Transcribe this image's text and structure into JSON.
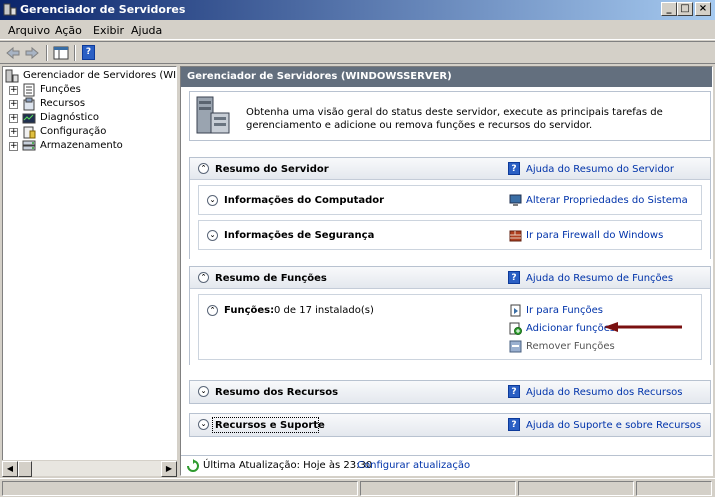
{
  "window": {
    "title": "Gerenciador de Servidores",
    "controls": {
      "minimize": "_",
      "maximize": "□",
      "close": "×"
    }
  },
  "menu": [
    "Arquivo",
    "Ação",
    "Exibir",
    "Ajuda"
  ],
  "toolbar": {
    "icons": [
      "back-arrow-icon",
      "forward-arrow-icon",
      "show-hide-console-tree-icon",
      "help-icon"
    ],
    "help_glyph": "?"
  },
  "tree": {
    "root": "Gerenciador de Servidores (WINDC",
    "items": [
      {
        "label": "Funções",
        "icon": "roles-icon"
      },
      {
        "label": "Recursos",
        "icon": "features-icon"
      },
      {
        "label": "Diagnóstico",
        "icon": "diagnostics-icon"
      },
      {
        "label": "Configuração",
        "icon": "configuration-icon"
      },
      {
        "label": "Armazenamento",
        "icon": "storage-icon"
      }
    ],
    "expander": "+"
  },
  "main": {
    "header": "Gerenciador de Servidores (WINDOWSSERVER)",
    "overview_text": "Obtenha uma visão geral do status deste servidor, execute as principais tarefas de gerenciamento e adicione ou remova funções e recursos do servidor.",
    "server_summary": {
      "title": "Resumo do Servidor",
      "help_link": "Ajuda do Resumo do Servidor",
      "computer_info": {
        "title": "Informações do Computador",
        "link": "Alterar Propriedades do Sistema"
      },
      "security_info": {
        "title": "Informações de Segurança",
        "link": "Ir para Firewall do Windows"
      }
    },
    "roles_summary": {
      "title": "Resumo de Funções",
      "help_link": "Ajuda do Resumo de Funções",
      "roles_label": "Funções:",
      "roles_value": "0 de 17 instalado(s)",
      "links": [
        "Ir para Funções",
        "Adicionar funções",
        "Remover Funções"
      ]
    },
    "features_summary": {
      "title": "Resumo dos Recursos",
      "help_link": "Ajuda do Resumo dos Recursos"
    },
    "resources_support": {
      "title": "Recursos e Suporte",
      "help_link": "Ajuda do Suporte e sobre Recursos"
    },
    "refresh": {
      "text": "Última Atualização: Hoje às 23:30",
      "link": "Configurar atualização"
    },
    "chevrons": {
      "up": "⌃",
      "down": "⌄"
    }
  },
  "colors": {
    "title_gradient_start": "#0a246a",
    "header_bar": "#636f7e",
    "link": "#0033aa",
    "annotation_arrow": "#7a1010"
  }
}
